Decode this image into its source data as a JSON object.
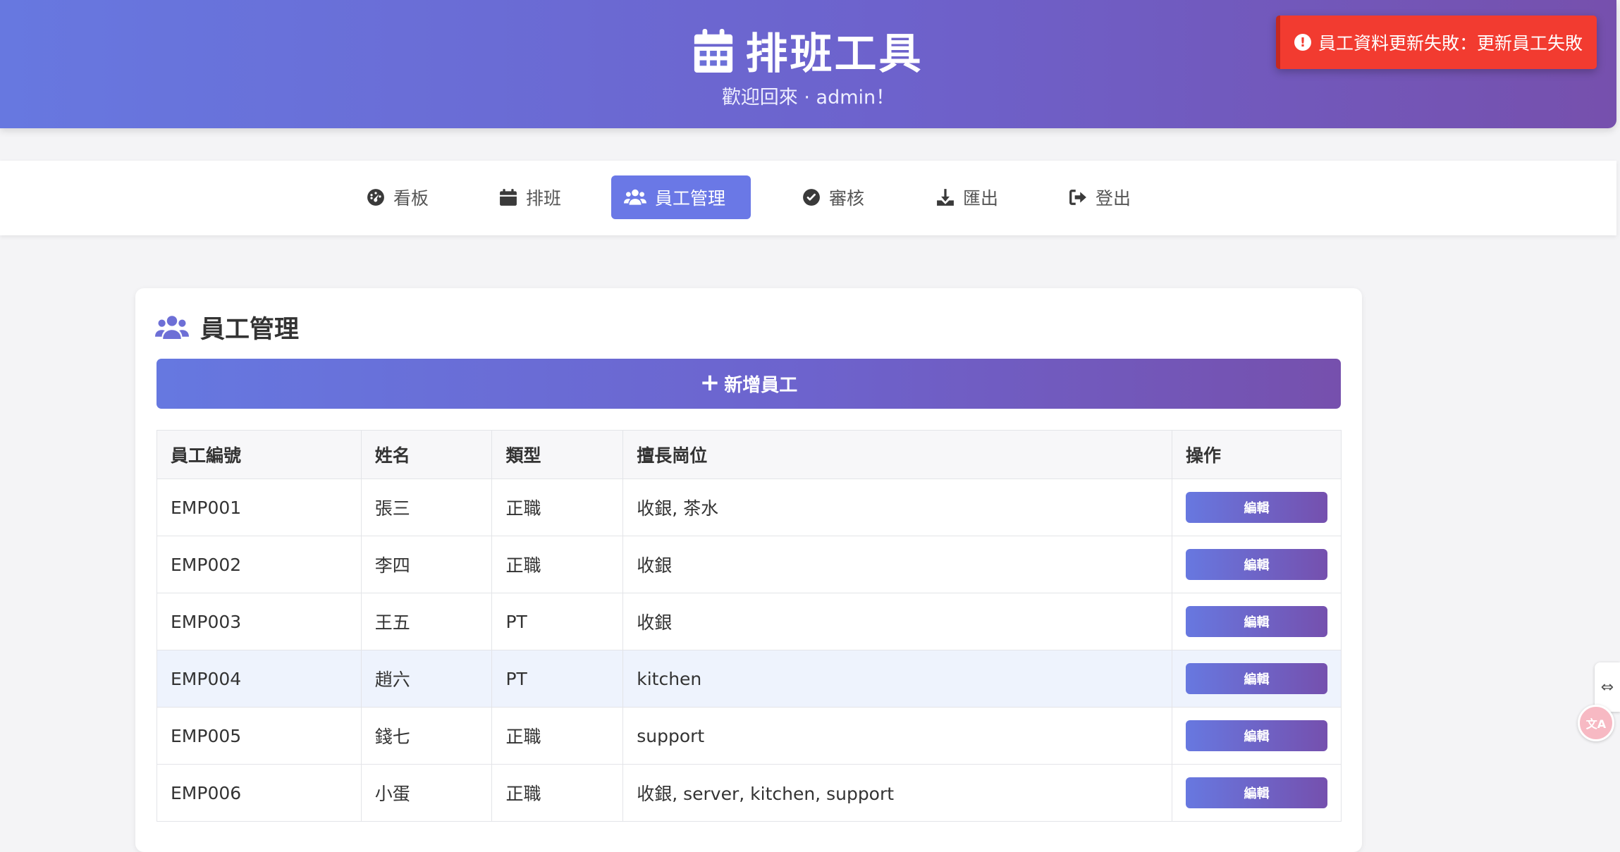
{
  "header": {
    "title": "排班工具",
    "subtitle": "歡迎回來 · admin！",
    "icon": "calendar-icon"
  },
  "toast": {
    "message": "員工資料更新失敗：更新員工失敗",
    "icon": "exclamation-circle-icon",
    "color": "#f23b30"
  },
  "nav": {
    "items": [
      {
        "label": "看板",
        "icon": "dashboard-icon"
      },
      {
        "label": "排班",
        "icon": "calendar-icon"
      },
      {
        "label": "員工管理",
        "icon": "users-icon",
        "active": true
      },
      {
        "label": "審核",
        "icon": "check-circle-icon"
      },
      {
        "label": "匯出",
        "icon": "download-icon"
      },
      {
        "label": "登出",
        "icon": "logout-icon"
      }
    ]
  },
  "card": {
    "title": "員工管理",
    "add_label": "新增員工"
  },
  "table": {
    "headers": [
      "員工編號",
      "姓名",
      "類型",
      "擅長崗位",
      "操作"
    ],
    "edit_label": "編輯",
    "rows": [
      {
        "id": "EMP001",
        "name": "張三",
        "type": "正職",
        "positions": "收銀, 茶水"
      },
      {
        "id": "EMP002",
        "name": "李四",
        "type": "正職",
        "positions": "收銀"
      },
      {
        "id": "EMP003",
        "name": "王五",
        "type": "PT",
        "positions": "收銀"
      },
      {
        "id": "EMP004",
        "name": "趙六",
        "type": "PT",
        "positions": "kitchen"
      },
      {
        "id": "EMP005",
        "name": "錢七",
        "type": "正職",
        "positions": "support"
      },
      {
        "id": "EMP006",
        "name": "小蛋",
        "type": "正職",
        "positions": "收銀, server, kitchen, support"
      }
    ]
  },
  "colors": {
    "accent": "#6a78e6",
    "gradient_start": "#6778e0",
    "gradient_end": "#7650ad",
    "error": "#f23b30"
  }
}
